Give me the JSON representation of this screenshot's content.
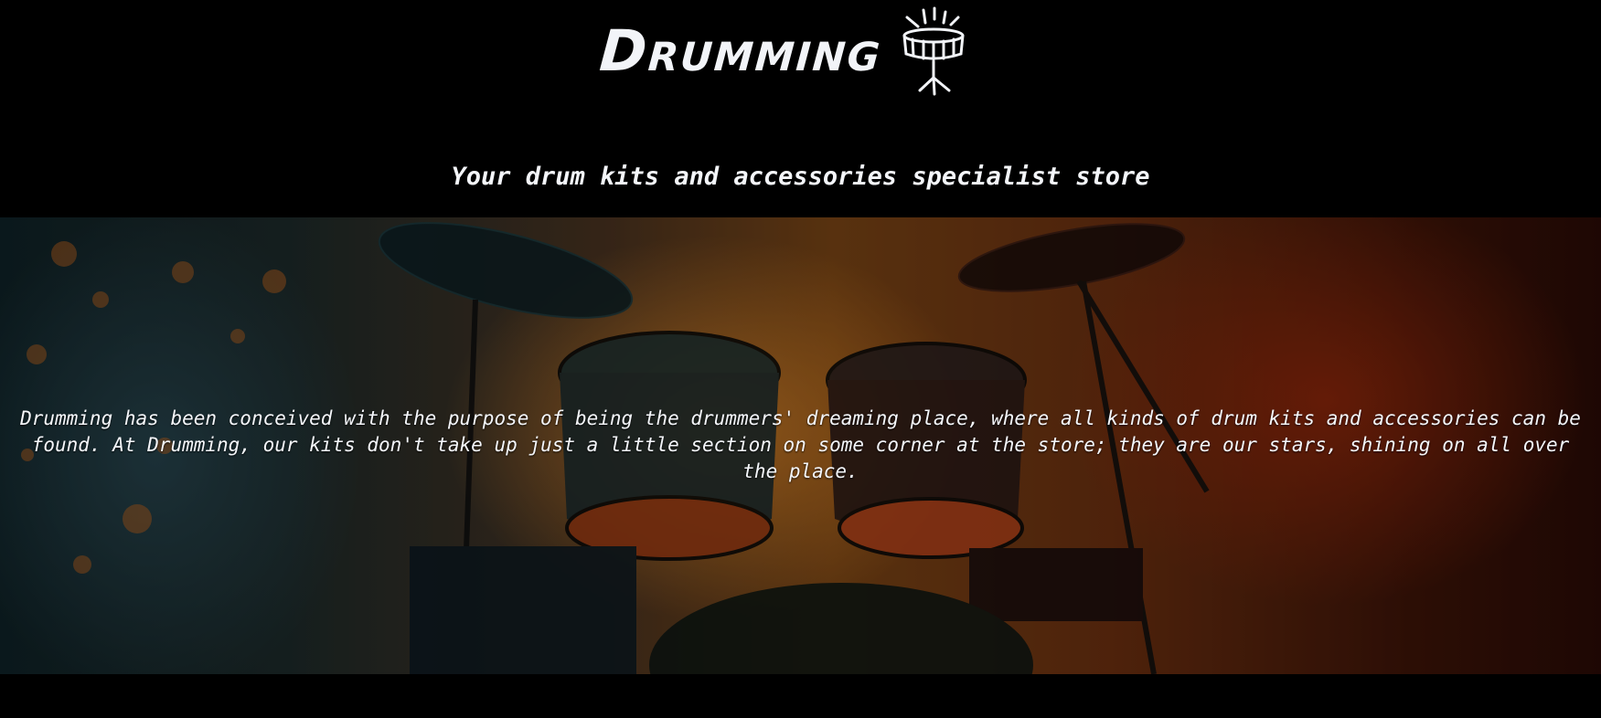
{
  "header": {
    "logo_text": "Drumming",
    "tagline": "Your drum kits and accessories specialist store"
  },
  "hero": {
    "description": "Drumming has been conceived with the purpose of being the drummers' dreaming place, where all kinds of drum kits and accessories can be found. At Drumming, our kits don't take up just a little section on some corner at the store; they are our stars, shining on all over the place."
  },
  "colors": {
    "background": "#000000",
    "text": "#f4f6fa",
    "accent_orange": "#e08a28",
    "accent_red": "#8a2a0c",
    "accent_teal": "#284650"
  },
  "icons": {
    "logo_icon": "drum-icon"
  }
}
